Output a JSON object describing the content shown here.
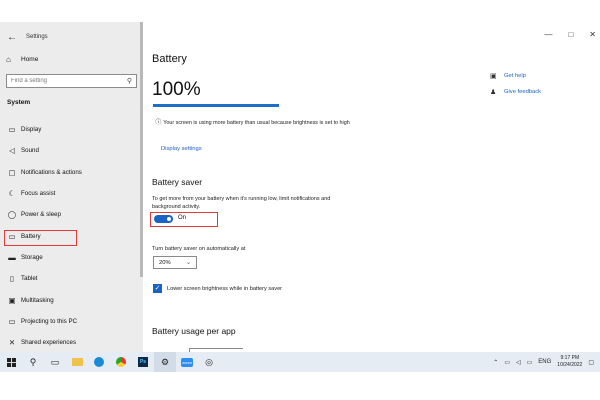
{
  "window": {
    "app_title": "Settings",
    "back_glyph": "←",
    "controls": {
      "minimize": "—",
      "maximize": "□",
      "close": "✕"
    }
  },
  "sidebar": {
    "home_label": "Home",
    "search_placeholder": "Find a setting",
    "section_label": "System",
    "items": [
      {
        "label": "Display",
        "icon": "display-icon",
        "glyph": "▭"
      },
      {
        "label": "Sound",
        "icon": "sound-icon",
        "glyph": "🔊"
      },
      {
        "label": "Notifications & actions",
        "icon": "notifications-icon",
        "glyph": "▢"
      },
      {
        "label": "Focus assist",
        "icon": "focus-assist-icon",
        "glyph": "☾"
      },
      {
        "label": "Power & sleep",
        "icon": "power-icon",
        "glyph": "⏻"
      },
      {
        "label": "Battery",
        "icon": "battery-icon",
        "glyph": "▭",
        "selected": true
      },
      {
        "label": "Storage",
        "icon": "storage-icon",
        "glyph": "▬"
      },
      {
        "label": "Tablet",
        "icon": "tablet-icon",
        "glyph": "▯"
      },
      {
        "label": "Multitasking",
        "icon": "multitasking-icon",
        "glyph": "▣"
      },
      {
        "label": "Projecting to this PC",
        "icon": "projecting-icon",
        "glyph": "▭"
      },
      {
        "label": "Shared experiences",
        "icon": "shared-experiences-icon",
        "glyph": "✕"
      }
    ]
  },
  "main": {
    "page_title": "Battery",
    "battery_percent": "100%",
    "battery_level": 1.0,
    "brightness_note": "Your screen is using more battery than usual because brightness is set to high",
    "display_settings_link": "Display settings",
    "battery_saver": {
      "heading": "Battery saver",
      "description": "To get more from your battery when it's running low, limit notifications and background activity.",
      "toggle_state": "On",
      "turn_on_label": "Turn battery saver on automatically at",
      "threshold_value": "20%",
      "lower_brightness_label": "Lower screen brightness while in battery saver",
      "lower_brightness_checked": true
    },
    "usage_heading": "Battery usage per app",
    "help_links": [
      {
        "label": "Get help",
        "icon": "get-help-icon",
        "glyph": "💬"
      },
      {
        "label": "Give feedback",
        "icon": "give-feedback-icon",
        "glyph": "👤"
      }
    ]
  },
  "taskbar": {
    "language": "ENG",
    "time": "9:17 PM",
    "date": "10/24/2022",
    "ps_label": "Ps",
    "zoom_label": "zoom"
  },
  "colors": {
    "accent": "#1a62c4",
    "highlight_box": "#e03a3a",
    "sidebar_bg": "#ececec",
    "taskbar_bg": "#e6ecf4"
  }
}
